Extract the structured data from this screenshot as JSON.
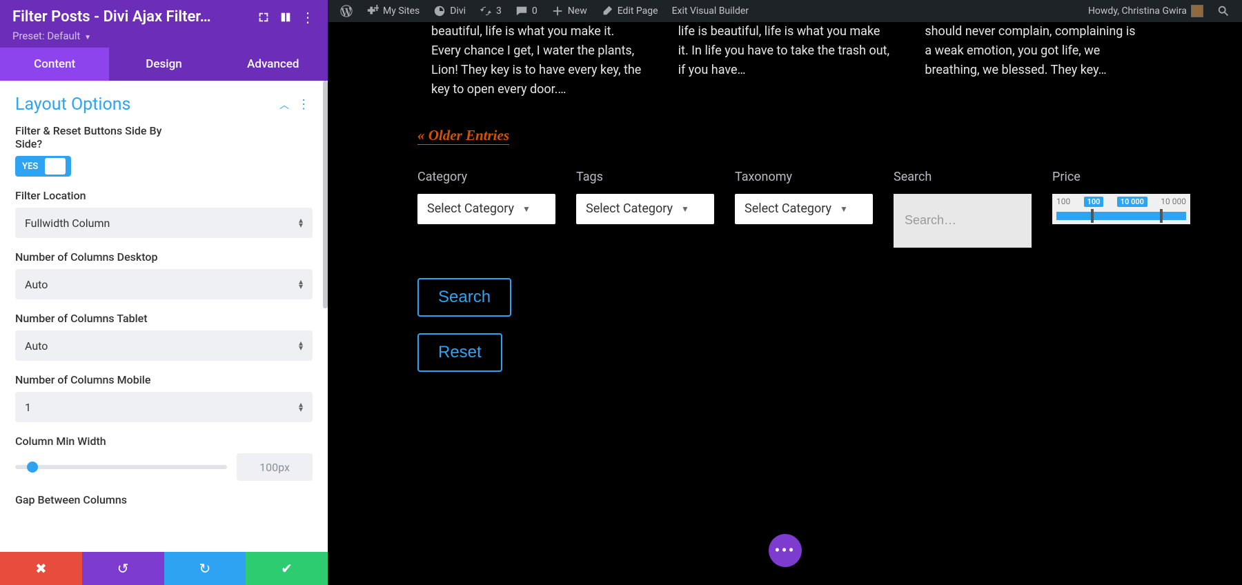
{
  "admin_bar": {
    "my_sites": "My Sites",
    "divi": "Divi",
    "updates_count": "3",
    "comments_count": "0",
    "new": "New",
    "edit_page": "Edit Page",
    "exit_vb": "Exit Visual Builder",
    "howdy": "Howdy, Christina Gwira"
  },
  "sidebar": {
    "title": "Filter Posts - Divi Ajax Filter…",
    "preset_label": "Preset: Default",
    "tabs": {
      "content": "Content",
      "design": "Design",
      "advanced": "Advanced"
    },
    "section_title": "Layout Options",
    "filter_reset_label": "Filter & Reset Buttons Side By Side?",
    "yes": "YES",
    "filter_location_label": "Filter Location",
    "filter_location_value": "Fullwidth Column",
    "cols_desktop_label": "Number of Columns Desktop",
    "cols_desktop_value": "Auto",
    "cols_tablet_label": "Number of Columns Tablet",
    "cols_tablet_value": "Auto",
    "cols_mobile_label": "Number of Columns Mobile",
    "cols_mobile_value": "1",
    "col_min_width_label": "Column Min Width",
    "col_min_width_value": "100px",
    "gap_label": "Gap Between Columns"
  },
  "canvas": {
    "posts": {
      "p1": "beautiful, life is what you make it. Every chance I get, I water the plants, Lion! They key is to have every key, the key to open every door.…",
      "p2": "life is beautiful, life is what you make it. In life you have to take the trash out, if you have…",
      "p3": "should never complain, complaining is a weak emotion, you got life, we breathing, we blessed. They key…"
    },
    "older_entries": "« Older Entries",
    "filters": {
      "category_label": "Category",
      "tags_label": "Tags",
      "taxonomy_label": "Taxonomy",
      "search_label": "Search",
      "price_label": "Price",
      "select_text": "Select Category",
      "search_placeholder": "Search…",
      "price_min": "100",
      "price_chip1": "100",
      "price_chip2": "10 000",
      "price_max": "10 000"
    },
    "search_btn": "Search",
    "reset_btn": "Reset"
  }
}
